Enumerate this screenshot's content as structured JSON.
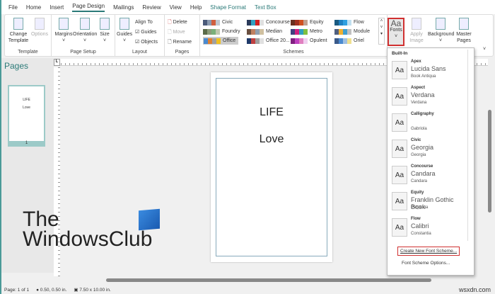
{
  "tabs": [
    "File",
    "Home",
    "Insert",
    "Page Design",
    "Mailings",
    "Review",
    "View",
    "Help",
    "Shape Format",
    "Text Box"
  ],
  "ribbon": {
    "template": {
      "change": "Change Template",
      "options": "Options",
      "label": "Template"
    },
    "page_setup": {
      "margins": "Margins",
      "orientation": "Orientation",
      "size": "Size",
      "label": "Page Setup"
    },
    "layout": {
      "guides": "Guides",
      "align_to": "Align To",
      "guides_check": "Guides",
      "objects_check": "Objects",
      "label": "Layout"
    },
    "pages": {
      "delete": "Delete",
      "move": "Move",
      "rename": "Rename",
      "label": "Pages"
    },
    "schemes": {
      "label": "Schemes",
      "items": [
        {
          "name": "Civic",
          "colors": [
            "#4a5a7a",
            "#8a9ab0",
            "#d06040",
            "#c0c8d0"
          ]
        },
        {
          "name": "Foundry",
          "colors": [
            "#5a6a4a",
            "#8a9a7a",
            "#7ab07a",
            "#c0c8b0"
          ]
        },
        {
          "name": "Office",
          "colors": [
            "#4a8ad0",
            "#e08030",
            "#a0a0a0",
            "#f0c020"
          ]
        },
        {
          "name": "Concourse",
          "colors": [
            "#2a3a5a",
            "#30a0c0",
            "#d02020",
            "#e0e0e0"
          ]
        },
        {
          "name": "Median",
          "colors": [
            "#6a5040",
            "#c08060",
            "#90a0b0",
            "#d0c0a0"
          ]
        },
        {
          "name": "Office 20...",
          "colors": [
            "#1f3a6a",
            "#c04040",
            "#a0a0a0",
            "#e0e0e0"
          ]
        },
        {
          "name": "Equity",
          "colors": [
            "#6a3020",
            "#a03020",
            "#d05020",
            "#c0a090"
          ]
        },
        {
          "name": "Metro",
          "colors": [
            "#404080",
            "#d02080",
            "#30a0c0",
            "#80c040"
          ]
        },
        {
          "name": "Opulent",
          "colors": [
            "#802080",
            "#c040c0",
            "#e080c0",
            "#f0d0f0"
          ]
        },
        {
          "name": "Flow",
          "colors": [
            "#1a5a80",
            "#2080c0",
            "#30a0e0",
            "#c0e0f0"
          ]
        },
        {
          "name": "Module",
          "colors": [
            "#506080",
            "#f0b030",
            "#40a0d0",
            "#c0c0c0"
          ]
        },
        {
          "name": "Oriel",
          "colors": [
            "#3a5a8a",
            "#4a8ad0",
            "#a0c0e0",
            "#f0e090"
          ]
        }
      ]
    },
    "fonts": "Fonts",
    "apply_image": "Apply Image",
    "background": "Background",
    "master_pages": "Master Pages"
  },
  "pages_panel": {
    "title": "Pages",
    "thumb_text": [
      "LIFE",
      "Love"
    ],
    "page_number": "1"
  },
  "ruler": {
    "corner": "L"
  },
  "document": {
    "line1": "LIFE",
    "line2": "Love"
  },
  "watermark": {
    "line1": "The",
    "line2": "WindowsClub"
  },
  "fonts_dropdown": {
    "section": "Built-In",
    "items": [
      {
        "name": "Apex",
        "heading": "Lucida Sans",
        "body": "Book Antiqua"
      },
      {
        "name": "Aspect",
        "heading": "Verdana",
        "body": "Verdana"
      },
      {
        "name": "Calligraphy",
        "heading": "",
        "body": "Gabriola"
      },
      {
        "name": "Civic",
        "heading": "Georgia",
        "body": "Georgia"
      },
      {
        "name": "Concourse",
        "heading": "Candara",
        "body": "Candara"
      },
      {
        "name": "Equity",
        "heading": "Franklin Gothic Book",
        "body": "Perpetua"
      },
      {
        "name": "Flow",
        "heading": "Calibri",
        "body": "Constantia"
      }
    ],
    "preview": "Aa",
    "create": "Create New Font Scheme...",
    "options": "Font Scheme Options..."
  },
  "status": {
    "page": "Page: 1 of 1",
    "position": "0.50, 0.50 in.",
    "size": "7.50 x 10.00 in."
  },
  "site": "wsxdn.com",
  "accent": "#2b7a78",
  "highlight": "#d03030"
}
